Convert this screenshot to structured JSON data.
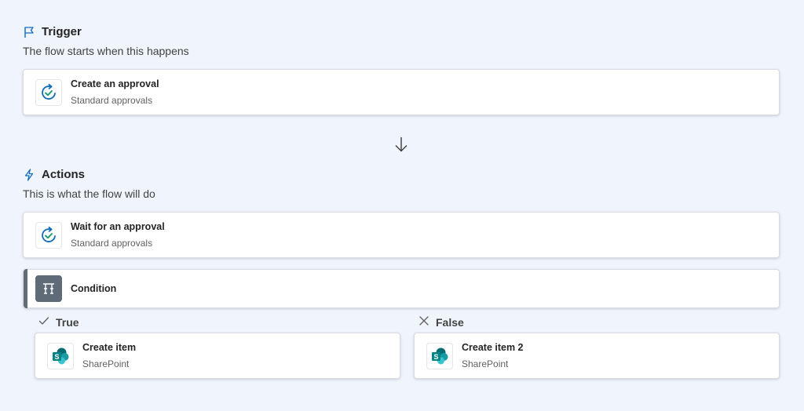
{
  "trigger": {
    "heading": "Trigger",
    "subheading": "The flow starts when this happens",
    "icon": "flag-icon",
    "card": {
      "title": "Create an approval",
      "subtitle": "Standard approvals",
      "icon": "approval-icon"
    }
  },
  "connector": {
    "icon": "arrow-down-icon"
  },
  "actions": {
    "heading": "Actions",
    "subheading": "This is what the flow will do",
    "icon": "lightning-icon",
    "cards": [
      {
        "title": "Wait for an approval",
        "subtitle": "Standard approvals",
        "icon": "approval-icon"
      }
    ],
    "condition": {
      "title": "Condition",
      "icon": "condition-icon"
    }
  },
  "branches": {
    "true": {
      "label": "True",
      "icon": "checkmark-icon",
      "card": {
        "title": "Create item",
        "subtitle": "SharePoint",
        "icon": "sharepoint-icon"
      }
    },
    "false": {
      "label": "False",
      "icon": "close-icon",
      "card": {
        "title": "Create item 2",
        "subtitle": "SharePoint",
        "icon": "sharepoint-icon"
      }
    }
  },
  "colors": {
    "background": "#f0f4fc",
    "accent_blue": "#0f6cbd",
    "approval_teal": "#1b9b74",
    "condition_gray": "#5f6b77",
    "sharepoint_teal": "#038387"
  }
}
